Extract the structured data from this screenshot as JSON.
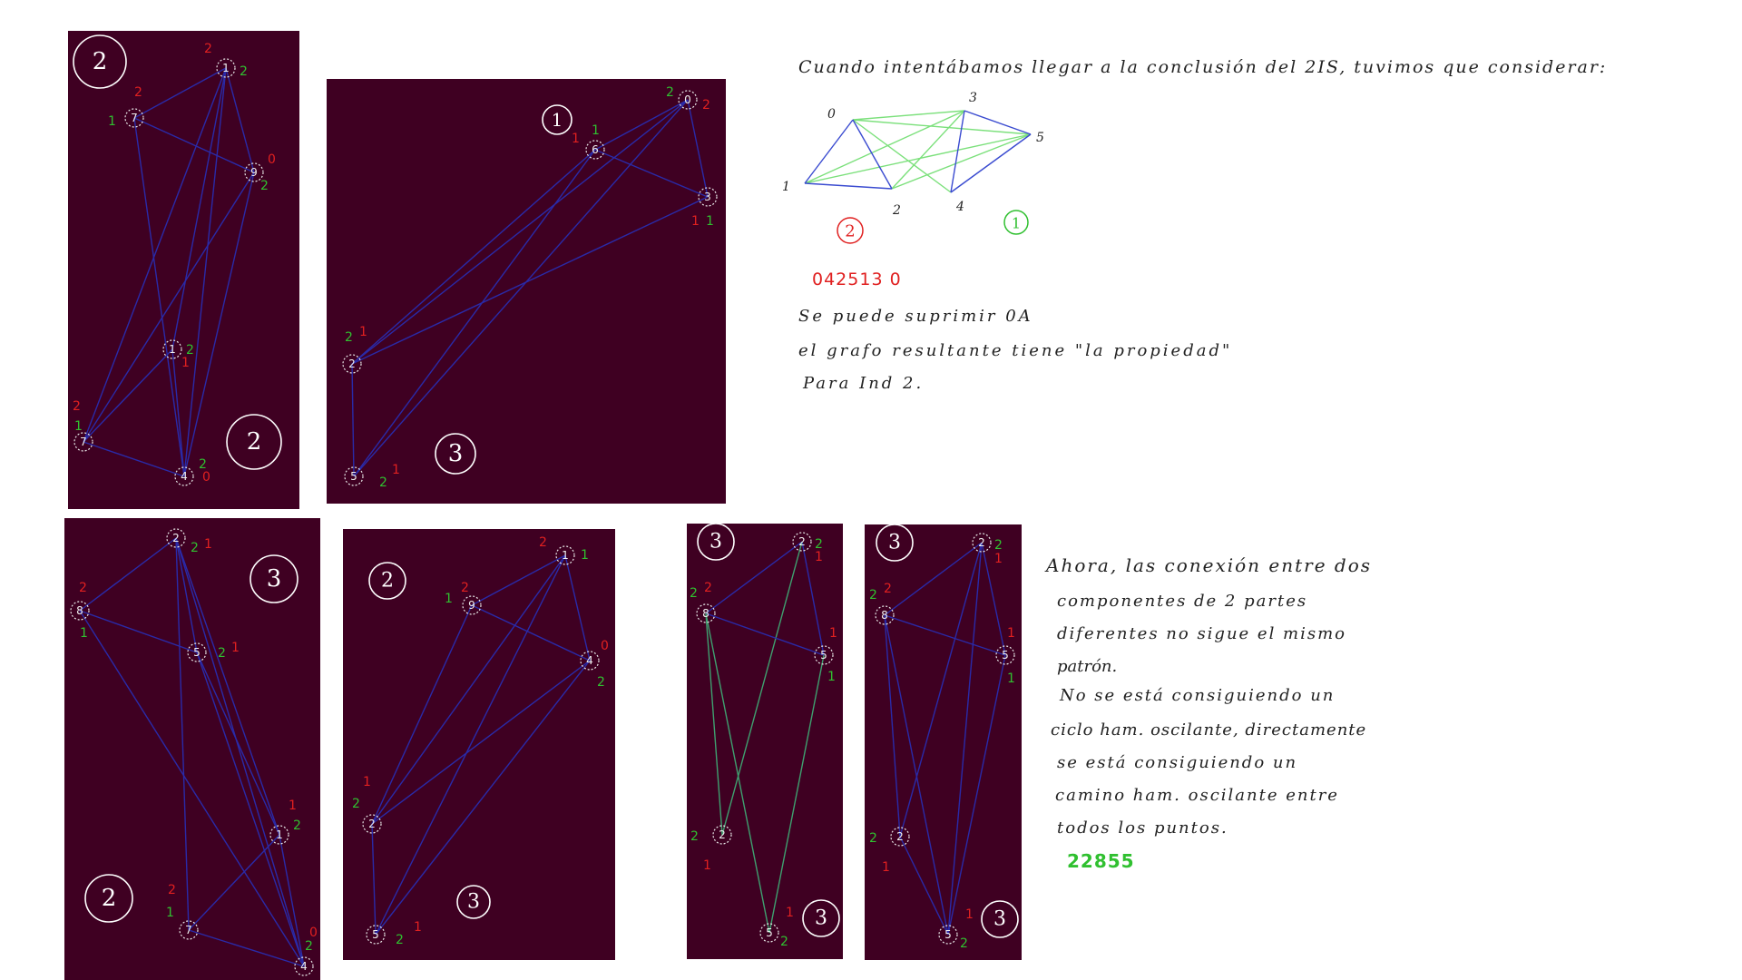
{
  "colors": {
    "panel": "#3f0022",
    "edge": "#2a2aa8",
    "edge_green": "#3fa070",
    "label_red": "#e02020",
    "label_green": "#30c030",
    "diagram_green": "#7be07b",
    "diagram_blue": "#3a4bd0"
  },
  "notes": {
    "top": {
      "line1": "Cuando intentábamos llegar a la conclusión del 2IS, tuvimos que considerar:",
      "sequence": "042513 0",
      "line2": "Se puede suprimir 0A",
      "line3": "el grafo resultante tiene \"la propiedad\"",
      "line4": "Para Ind 2.",
      "circle_red": "2",
      "circle_green": "1"
    },
    "bottom": {
      "line1": "Ahora, las conexión entre dos",
      "line2": "componentes de 2 partes",
      "line3": "diferentes no sigue el mismo",
      "line4": "patrón.",
      "line5": "No se está consiguiendo un",
      "line6": "ciclo ham. oscilante, directamente",
      "line7": "se está consiguiendo un",
      "line8": "camino ham. oscilante entre",
      "line9": "todos los puntos.",
      "sequence": "22855"
    }
  },
  "mini_graph": {
    "nodes": [
      "0",
      "1",
      "2",
      "3",
      "4",
      "5"
    ]
  },
  "panels": [
    {
      "id": "p1",
      "circled": [
        "2",
        "2"
      ],
      "nodes": [
        {
          "label": "1"
        },
        {
          "label": "7"
        },
        {
          "label": "9"
        },
        {
          "label": "1"
        },
        {
          "label": "7"
        },
        {
          "label": "4"
        }
      ],
      "tags": [
        "2",
        "2",
        "2",
        "1",
        "0",
        "2",
        "2",
        "1",
        "2",
        "1",
        "2",
        "0"
      ]
    },
    {
      "id": "p2",
      "circled": [
        "1",
        "3"
      ],
      "nodes": [
        {
          "label": "0"
        },
        {
          "label": "6"
        },
        {
          "label": "3"
        },
        {
          "label": "2"
        },
        {
          "label": "5"
        }
      ],
      "tags": [
        "2",
        "2",
        "1",
        "1",
        "1",
        "1",
        "2",
        "1",
        "2",
        "1"
      ]
    },
    {
      "id": "p3",
      "circled": [
        "3",
        "2"
      ],
      "nodes": [
        {
          "label": "2"
        },
        {
          "label": "8"
        },
        {
          "label": "5"
        },
        {
          "label": "1"
        },
        {
          "label": "7"
        },
        {
          "label": "4"
        }
      ],
      "tags": [
        "2",
        "1",
        "2",
        "1",
        "2",
        "1",
        "1",
        "2",
        "2",
        "1",
        "0",
        "2"
      ]
    },
    {
      "id": "p4",
      "circled": [
        "2",
        "3"
      ],
      "nodes": [
        {
          "label": "1"
        },
        {
          "label": "9"
        },
        {
          "label": "4"
        },
        {
          "label": "2"
        },
        {
          "label": "5"
        }
      ],
      "tags": [
        "2",
        "1",
        "1",
        "2",
        "0",
        "2",
        "1",
        "2",
        "2",
        "1"
      ]
    },
    {
      "id": "p5",
      "circled": [
        "3",
        "3"
      ],
      "nodes": [
        {
          "label": "2"
        },
        {
          "label": "8"
        },
        {
          "label": "5"
        },
        {
          "label": "2"
        },
        {
          "label": "5"
        }
      ],
      "tags": [
        "2",
        "1",
        "2",
        "2",
        "1",
        "1",
        "2",
        "1",
        "1",
        "2"
      ]
    },
    {
      "id": "p6",
      "circled": [
        "3",
        "3"
      ],
      "nodes": [
        {
          "label": "2"
        },
        {
          "label": "8"
        },
        {
          "label": "5"
        },
        {
          "label": "2"
        },
        {
          "label": "5"
        }
      ],
      "tags": [
        "2",
        "1",
        "2",
        "2",
        "1",
        "1",
        "2",
        "1",
        "1",
        "2"
      ]
    }
  ]
}
